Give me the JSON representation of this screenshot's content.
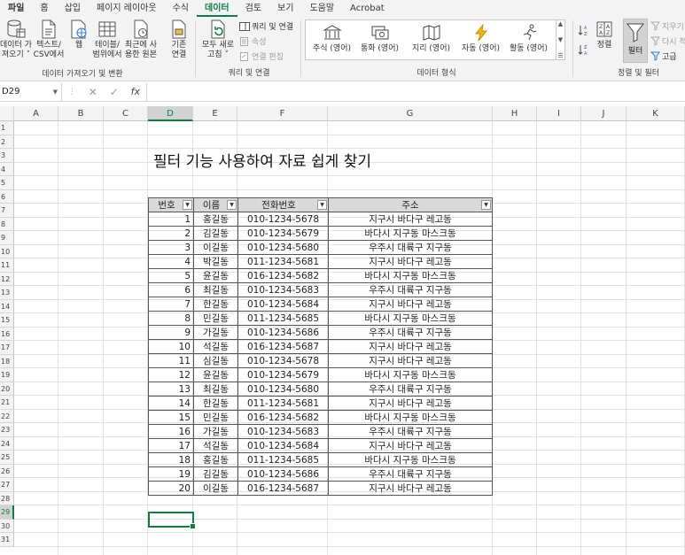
{
  "menu": [
    "파일",
    "홈",
    "삽입",
    "페이지 레이아웃",
    "수식",
    "데이터",
    "검토",
    "보기",
    "도움말",
    "Acrobat"
  ],
  "menu_active_index": 5,
  "ribbon": {
    "get_data": {
      "line1": "데이터 가",
      "line2": "져오기 ˅"
    },
    "text_csv": {
      "line1": "텍스트/",
      "line2": "CSV에서"
    },
    "web": {
      "line1": "웹"
    },
    "table_range": {
      "line1": "테이블/",
      "line2": "범위에서"
    },
    "recent_sources": {
      "line1": "최근에 사",
      "line2": "용한 원본"
    },
    "existing_conn": {
      "line1": "기존",
      "line2": "연결"
    },
    "group_get_transform": "데이터 가져오기 및 변환",
    "refresh_all": {
      "line1": "모두 새로",
      "line2": "고침 ˅"
    },
    "queries_connections": "쿼리 및 연결",
    "properties": "속성",
    "edit_links": "연결 편집",
    "group_queries": "쿼리 및 연결",
    "data_types": [
      "주식 (영어)",
      "통화 (영어)",
      "지리 (영어)",
      "자동 (영어)",
      "활동 (영어)"
    ],
    "group_data_types": "데이터 형식",
    "sort_label": "정렬",
    "filter_label": "필터",
    "clear_label": "지우기",
    "reapply_label": "다시 적",
    "advanced_label": "고급",
    "group_sort_filter": "정렬 및 필터"
  },
  "formula_bar": {
    "name_box": "D29",
    "formula": ""
  },
  "columns": [
    "A",
    "B",
    "C",
    "D",
    "E",
    "F",
    "G",
    "H",
    "I",
    "J",
    "K"
  ],
  "selected_column": "D",
  "selected_row": 29,
  "title": "필터 기능 사용하여 자료 쉽게 찾기",
  "table": {
    "headers": [
      "번호",
      "이름",
      "전화번호",
      "주소"
    ],
    "rows": [
      [
        "1",
        "홍길동",
        "010-1234-5678",
        "지구시 바다구 레고동"
      ],
      [
        "2",
        "김길동",
        "010-1234-5679",
        "바다시 지구동 마스크동"
      ],
      [
        "3",
        "이길동",
        "010-1234-5680",
        "우주시 대륙구 지구동"
      ],
      [
        "4",
        "박길동",
        "011-1234-5681",
        "지구시 바다구 레고동"
      ],
      [
        "5",
        "윤길동",
        "016-1234-5682",
        "바다시 지구동 마스크동"
      ],
      [
        "6",
        "최길동",
        "010-1234-5683",
        "우주시 대륙구 지구동"
      ],
      [
        "7",
        "한길동",
        "010-1234-5684",
        "지구시 바다구 레고동"
      ],
      [
        "8",
        "민길동",
        "011-1234-5685",
        "바다시 지구동 마스크동"
      ],
      [
        "9",
        "가길동",
        "010-1234-5686",
        "우주시 대륙구 지구동"
      ],
      [
        "10",
        "석길동",
        "016-1234-5687",
        "지구시 바다구 레고동"
      ],
      [
        "11",
        "심길동",
        "010-1234-5678",
        "지구시 바다구 레고동"
      ],
      [
        "12",
        "윤길동",
        "010-1234-5679",
        "바다시 지구동 마스크동"
      ],
      [
        "13",
        "최길동",
        "010-1234-5680",
        "우주시 대륙구 지구동"
      ],
      [
        "14",
        "한길동",
        "011-1234-5681",
        "지구시 바다구 레고동"
      ],
      [
        "15",
        "민길동",
        "016-1234-5682",
        "바다시 지구동 마스크동"
      ],
      [
        "16",
        "가길동",
        "010-1234-5683",
        "우주시 대륙구 지구동"
      ],
      [
        "17",
        "석길동",
        "010-1234-5684",
        "지구시 바다구 레고동"
      ],
      [
        "18",
        "홍길동",
        "011-1234-5685",
        "바다시 지구동 마스크동"
      ],
      [
        "19",
        "김길동",
        "010-1234-5686",
        "우주시 대륙구 지구동"
      ],
      [
        "20",
        "이길동",
        "016-1234-5687",
        "지구시 바다구 레고동"
      ]
    ]
  }
}
